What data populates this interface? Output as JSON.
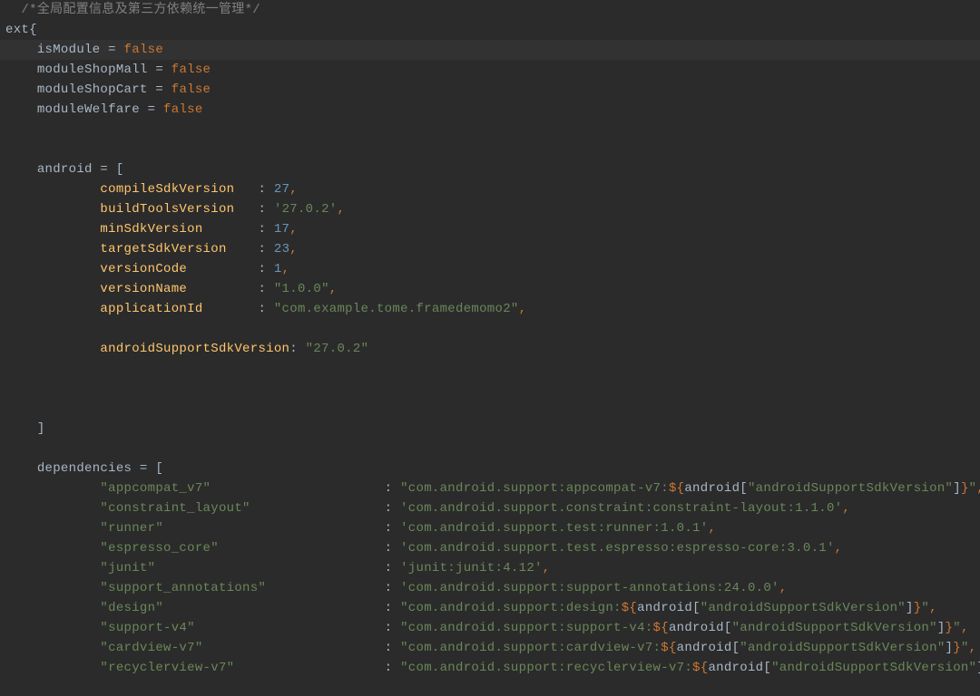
{
  "code": {
    "comment": "/*全局配置信息及第三方依赖统一管理*/",
    "extOpen": "ext{",
    "vars": {
      "isModule": {
        "name": "isModule",
        "eq": " = ",
        "val": "false"
      },
      "moduleShopMall": {
        "name": "moduleShopMall",
        "eq": " = ",
        "val": "false"
      },
      "moduleShopCart": {
        "name": "moduleShopCart",
        "eq": " = ",
        "val": "false"
      },
      "moduleWelfare": {
        "name": "moduleWelfare",
        "eq": " = ",
        "val": "false"
      }
    },
    "androidOpen": {
      "name": "android",
      "eq": " = [",
      "val": ""
    },
    "androidMap": {
      "compileSdkVersion": {
        "key": "compileSdkVersion",
        "pad": "   : ",
        "val": "27",
        "type": "num",
        "comma": ","
      },
      "buildToolsVersion": {
        "key": "buildToolsVersion",
        "pad": "   : ",
        "val": "'27.0.2'",
        "type": "str",
        "comma": ","
      },
      "minSdkVersion": {
        "key": "minSdkVersion",
        "pad": "       : ",
        "val": "17",
        "type": "num",
        "comma": ","
      },
      "targetSdkVersion": {
        "key": "targetSdkVersion",
        "pad": "    : ",
        "val": "23",
        "type": "num",
        "comma": ","
      },
      "versionCode": {
        "key": "versionCode",
        "pad": "         : ",
        "val": "1",
        "type": "num",
        "comma": ","
      },
      "versionName": {
        "key": "versionName",
        "pad": "         : ",
        "val": "\"1.0.0\"",
        "type": "str",
        "comma": ","
      },
      "applicationId": {
        "key": "applicationId",
        "pad": "       : ",
        "val": "\"com.example.tome.framedemomo2\"",
        "type": "str",
        "comma": ","
      },
      "androidSupportSdkVersion": {
        "key": "androidSupportSdkVersion",
        "pad": ": ",
        "val": "\"27.0.2\"",
        "type": "str",
        "comma": ""
      }
    },
    "androidClose": "]",
    "depsOpen": {
      "name": "dependencies",
      "eq": " = ["
    },
    "deps": {
      "appcompat_v7": {
        "key": "\"appcompat_v7\"",
        "pre": "\"com.android.support:appcompat-v7:",
        "interp": {
          "open": "${",
          "a": "android",
          "b": "[",
          "c": "\"androidSupportSdkVersion\"",
          "d": "]",
          "close": "}"
        },
        "post": "\"",
        "comma": ","
      },
      "constraint_layout": {
        "key": "\"constraint_layout\"",
        "plain": "'com.android.support.constraint:constraint-layout:1.1.0'",
        "comma": ","
      },
      "runner": {
        "key": "\"runner\"",
        "plain": "'com.android.support.test:runner:1.0.1'",
        "comma": ","
      },
      "espresso_core": {
        "key": "\"espresso_core\"",
        "plain": "'com.android.support.test.espresso:espresso-core:3.0.1'",
        "comma": ","
      },
      "junit": {
        "key": "\"junit\"",
        "plain": "'junit:junit:4.12'",
        "comma": ","
      },
      "support_annotations": {
        "key": "\"support_annotations\"",
        "plain": "'com.android.support:support-annotations:24.0.0'",
        "comma": ","
      },
      "design": {
        "key": "\"design\"",
        "pre": "\"com.android.support:design:",
        "interp": {
          "open": "${",
          "a": "android",
          "b": "[",
          "c": "\"androidSupportSdkVersion\"",
          "d": "]",
          "close": "}"
        },
        "post": "\"",
        "comma": ","
      },
      "support_v4": {
        "key": "\"support-v4\"",
        "pre": "\"com.android.support:support-v4:",
        "interp": {
          "open": "${",
          "a": "android",
          "b": "[",
          "c": "\"androidSupportSdkVersion\"",
          "d": "]",
          "close": "}"
        },
        "post": "\"",
        "comma": ","
      },
      "cardview_v7": {
        "key": "\"cardview-v7\"",
        "pre": "\"com.android.support:cardview-v7:",
        "interp": {
          "open": "${",
          "a": "android",
          "b": "[",
          "c": "\"androidSupportSdkVersion\"",
          "d": "]",
          "close": "}"
        },
        "post": "\"",
        "comma": ","
      },
      "recyclerview_v7": {
        "key": "\"recyclerview-v7\"",
        "pre": "\"com.android.support:recyclerview-v7:",
        "interp": {
          "open": "${",
          "a": "android",
          "b": "[",
          "c": "\"androidSupportSdkVersion\"",
          "d": "]",
          "close": "}"
        },
        "post": "\"",
        "comma": ","
      }
    },
    "depPad": {
      "appcompat_v7": "                      : ",
      "constraint_layout": "                 : ",
      "runner": "                            : ",
      "espresso_core": "                     : ",
      "junit": "                             : ",
      "support_annotations": "               : ",
      "design": "                            : ",
      "support_v4": "                        : ",
      "cardview_v7": "                       : ",
      "recyclerview_v7": "                   : "
    }
  }
}
